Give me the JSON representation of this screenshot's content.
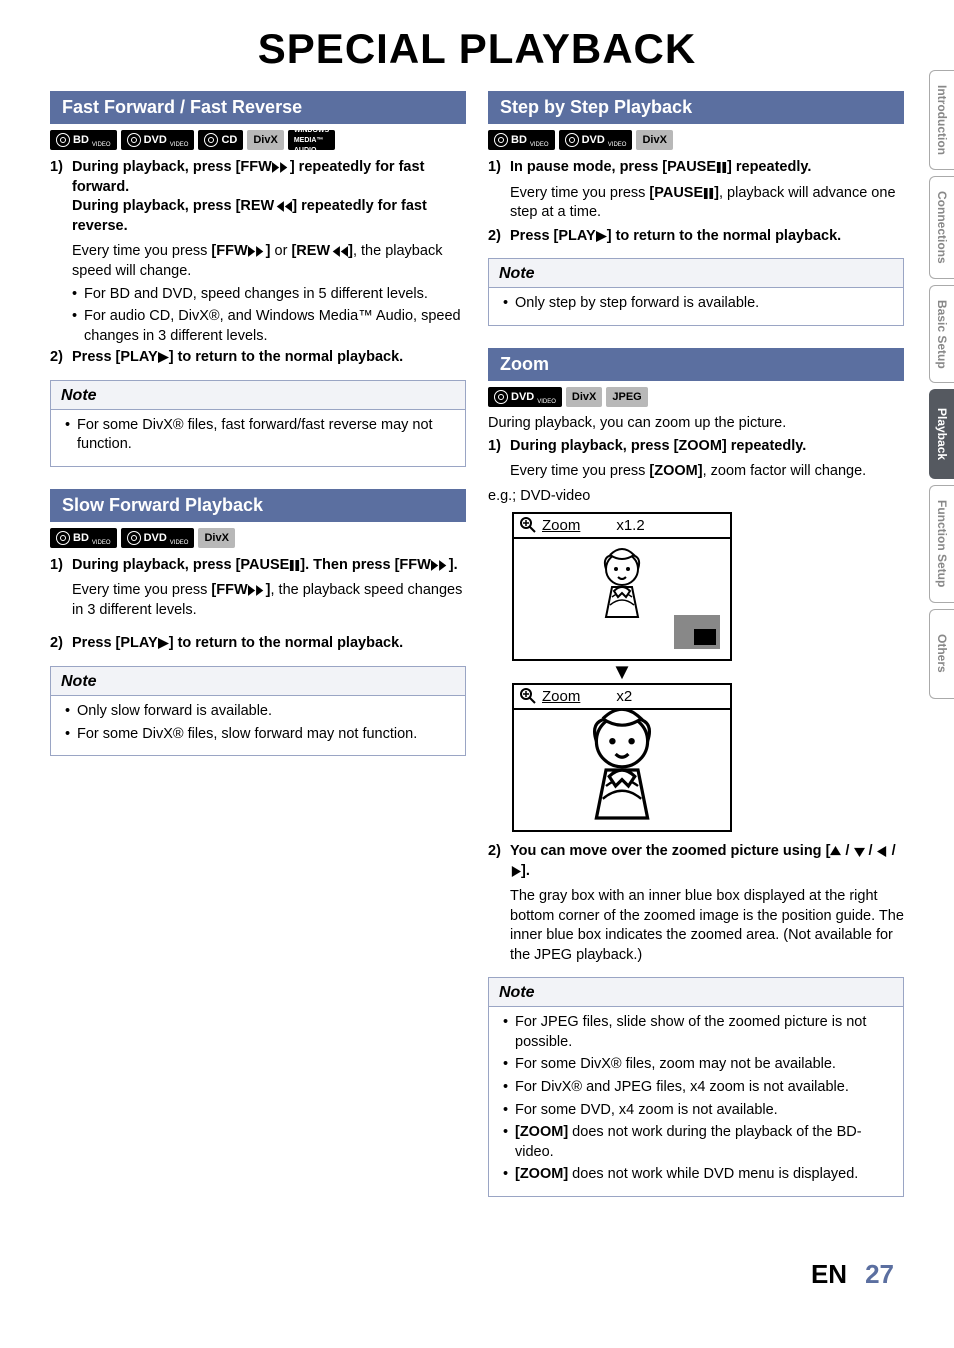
{
  "page_title": "SPECIAL PLAYBACK",
  "footer": {
    "lang": "EN",
    "page": "27"
  },
  "tabs": {
    "intro": "Introduction",
    "conn": "Connections",
    "basic": "Basic Setup",
    "playback": "Playback",
    "func": "Function Setup",
    "others": "Others"
  },
  "badges": {
    "bd": "BD",
    "bd_sub": "VIDEO",
    "dvd": "DVD",
    "dvd_sub": "VIDEO",
    "cd": "CD",
    "divx": "DivX",
    "wma_l1": "WINDOWS",
    "wma_l2": "MEDIA™",
    "wma_l3": "AUDIO",
    "jpeg": "JPEG"
  },
  "ffw": {
    "title": "Fast Forward / Fast Reverse",
    "s1_a": "During playback, press [FFW",
    "s1_b": "] repeatedly for fast forward.",
    "s1_c": "During playback, press [REW",
    "s1_d": "] repeatedly for fast reverse.",
    "s1_e": "Every time you press ",
    "s1_f": "[FFW",
    "s1_g": "]",
    "s1_h": " or ",
    "s1_i": "[REW",
    "s1_j": "]",
    "s1_k": ", the playback speed will change.",
    "b1": "For BD and DVD, speed changes in 5 different levels.",
    "b2": "For audio CD, DivX®, and Windows Media™ Audio, speed changes in 3 different levels.",
    "s2_a": "Press [PLAY",
    "s2_b": "] to return to the normal playback.",
    "note_title": "Note",
    "n1": "For some DivX® files, fast forward/fast reverse may not function."
  },
  "slow": {
    "title": "Slow Forward Playback",
    "s1_a": "During playback, press [PAUSE",
    "s1_b": "]. Then press [FFW",
    "s1_c": "].",
    "s1_d": "Every time you press ",
    "s1_e": "[FFW",
    "s1_f": "]",
    "s1_g": ", the playback speed changes in 3 different levels.",
    "s2_a": "Press [PLAY",
    "s2_b": "] to return to the normal playback.",
    "note_title": "Note",
    "n1": "Only slow forward is available.",
    "n2": "For some DivX® files, slow forward may not function."
  },
  "step": {
    "title": "Step by Step Playback",
    "s1_a": "In pause mode, press [PAUSE",
    "s1_b": "] repeatedly.",
    "s1_c": "Every time you press ",
    "s1_d": "[PAUSE",
    "s1_e": "]",
    "s1_f": ", playback will advance one step at a time.",
    "s2_a": "Press [PLAY",
    "s2_b": "] to return to the normal playback.",
    "note_title": "Note",
    "n1": "Only step by step forward is available."
  },
  "zoom": {
    "title": "Zoom",
    "intro": "During playback, you can zoom up the picture.",
    "s1_a": "During playback, press [ZOOM] repeatedly.",
    "s1_b": "Every time you press ",
    "s1_c": "[ZOOM]",
    "s1_d": ", zoom factor will change.",
    "eg": "e.g.; DVD-video",
    "z_label": "Zoom",
    "z_v1": "x1.2",
    "z_v2": "x2",
    "s2_a": "You can move over the zoomed picture using [",
    "s2_b": " / ",
    "s2_c": " / ",
    "s2_d": " / ",
    "s2_e": "].",
    "s2_f": "The gray box with an inner blue box displayed at the right bottom corner of the zoomed image is the position guide. The inner blue box indicates the zoomed area. (Not available for the JPEG playback.)",
    "note_title": "Note",
    "n1": "For JPEG files, slide show of the zoomed picture is not possible.",
    "n2": "For some DivX® files, zoom may not be available.",
    "n3": "For DivX® and JPEG files, x4 zoom is not available.",
    "n4": "For some DVD, x4 zoom is not available.",
    "n5_a": "[ZOOM]",
    "n5_b": " does not work during the playback of the BD-video.",
    "n6_a": "[ZOOM]",
    "n6_b": " does not work while DVD menu is displayed."
  }
}
